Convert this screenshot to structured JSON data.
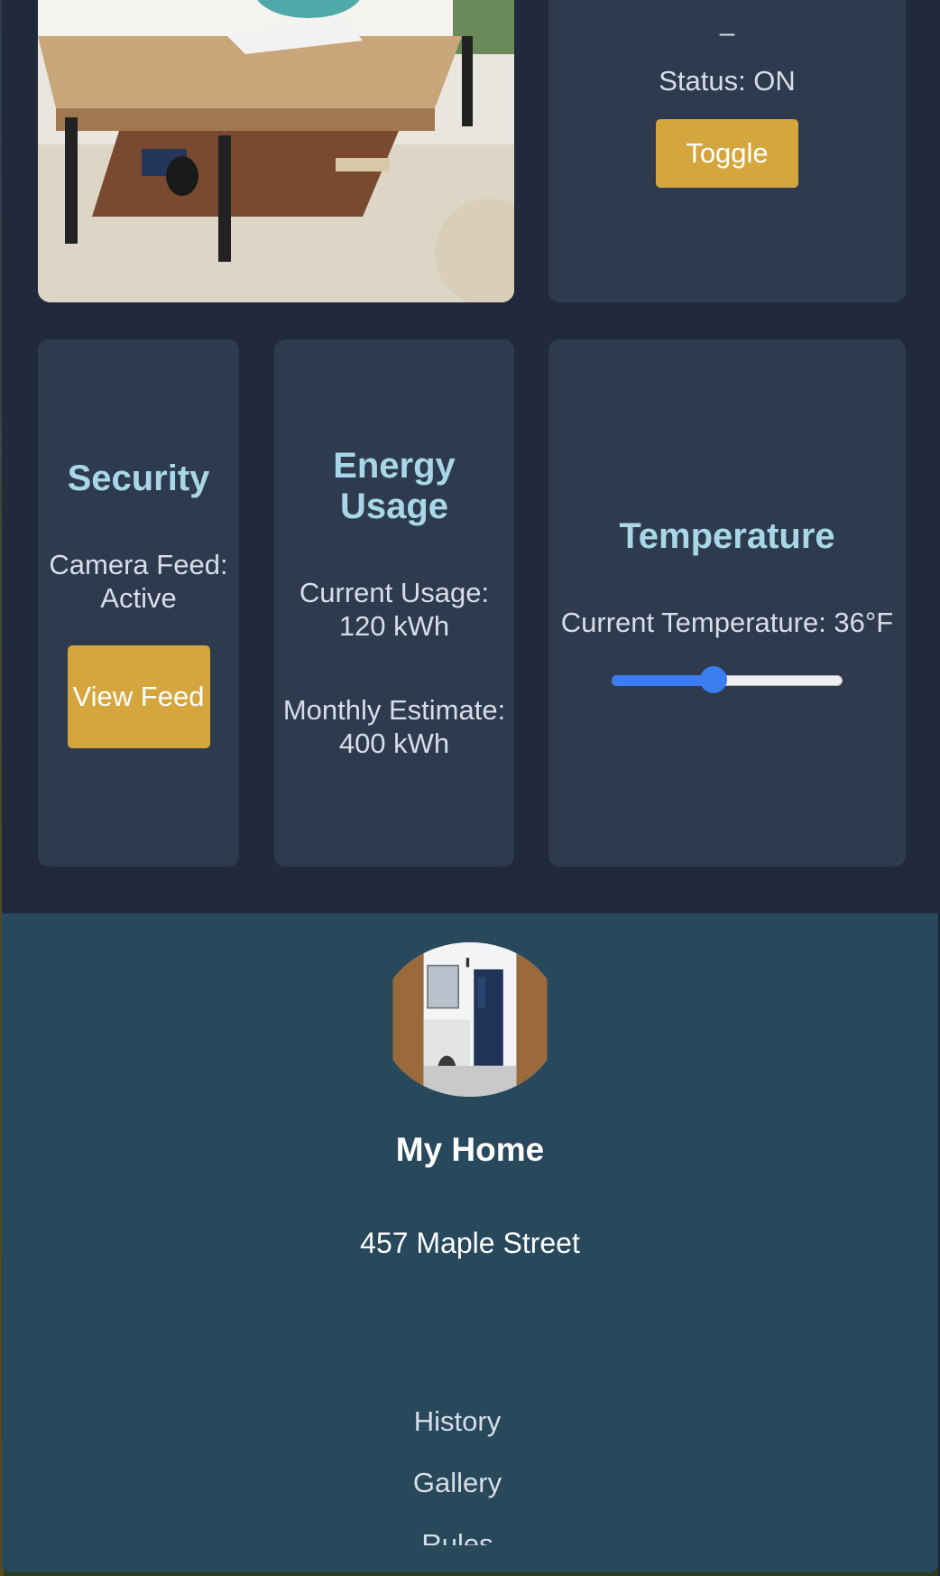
{
  "light_card": {
    "dash": "–",
    "status": "Status: ON",
    "toggle_label": "Toggle"
  },
  "security": {
    "title": "Security",
    "camera_status": "Camera Feed: Active",
    "view_label": "View Feed"
  },
  "energy": {
    "title": "Energy Usage",
    "current": "Current Usage: 120 kWh",
    "monthly": "Monthly Estimate: 400 kWh"
  },
  "temperature": {
    "title": "Temperature",
    "current": "Current Temperature: 36°F",
    "slider_fraction": 0.44
  },
  "profile": {
    "name": "My Home",
    "address": "457 Maple Street"
  },
  "nav": {
    "items": [
      "History",
      "Gallery",
      "Rules"
    ]
  },
  "colors": {
    "accent_button": "#d5a63e",
    "card_title": "#a8d8e8",
    "slider": "#3b7cf0",
    "profile_bg": "#28485c"
  }
}
